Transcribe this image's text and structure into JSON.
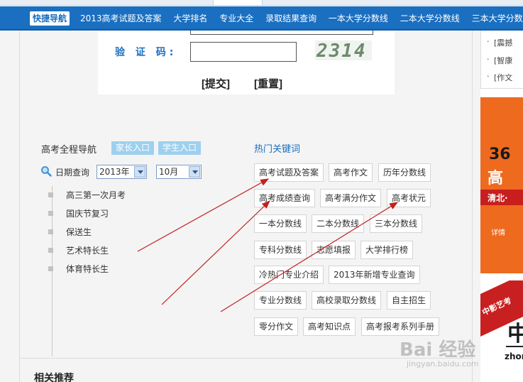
{
  "nav": {
    "quick_label": "快捷导航",
    "items": [
      "2013高考试题及答案",
      "大学排名",
      "专业大全",
      "录取结果查询",
      "一本大学分数线",
      "二本大学分数线",
      "三本大学分数线"
    ]
  },
  "form": {
    "captcha_label": "验 证 码:",
    "captcha_input_value": "",
    "captcha_image_text": "2314",
    "submit_label": "[提交]",
    "reset_label": "[重置]"
  },
  "guide": {
    "title": "高考全程导航",
    "tab_parent": "家长入口",
    "tab_student": "学生入口",
    "date_label": "日期查询",
    "year_value": "2013年",
    "month_value": "10月",
    "items": [
      "高三第一次月考",
      "国庆节复习",
      "保送生",
      "艺术特长生",
      "体育特长生"
    ]
  },
  "hot": {
    "title": "热门关键词",
    "rows": [
      [
        "高考试题及答案",
        "高考作文",
        "历年分数线"
      ],
      [
        "高考成绩查询",
        "高考满分作文",
        "高考状元"
      ],
      [
        "一本分数线",
        "二本分数线",
        "三本分数线"
      ],
      [
        "专科分数线",
        "志愿填报",
        "大学排行榜"
      ],
      [
        "冷热门专业介绍",
        "2013年新增专业查询"
      ],
      [
        "专业分数线",
        "高校录取分数线",
        "自主招生"
      ],
      [
        "零分作文",
        "高考知识点",
        "高考报考系列手册"
      ]
    ]
  },
  "related": {
    "title": "相关推荐"
  },
  "sidebar": {
    "links": [
      "[震撼",
      "[智康",
      "[作文"
    ],
    "ad1": {
      "number": "36",
      "big_text": "高",
      "bar_text": "清北·",
      "small_text": "详情"
    },
    "ad2": {
      "banner_text": "中影艺考",
      "big_char": "中",
      "eng_text": "zhon"
    }
  },
  "watermark": {
    "logo": "Bai 经验",
    "sub": "jingyan.baidu.com"
  },
  "colors": {
    "nav_blue": "#1a6fc0",
    "tab_blue": "#9ed0ef",
    "arrow_red": "#c21f1f",
    "ad_orange": "#ee6a1f"
  }
}
